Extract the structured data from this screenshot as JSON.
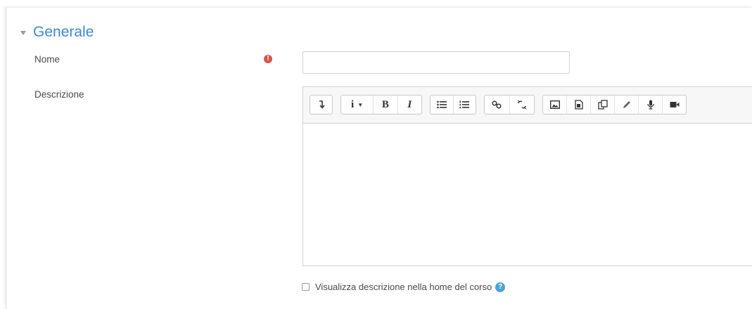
{
  "section": {
    "title": "Generale",
    "collapse_icon": "caret-down-icon"
  },
  "fields": {
    "name": {
      "label": "Nome",
      "required_icon": "exclamation-circle-icon",
      "required_color": "#d9534f",
      "value": "",
      "placeholder": ""
    },
    "description": {
      "label": "Descrizione",
      "content": ""
    }
  },
  "toolbar": {
    "groups": [
      {
        "buttons": [
          {
            "icon": "show-more-buttons-icon",
            "glyph": "↴"
          }
        ]
      },
      {
        "buttons": [
          {
            "icon": "paragraph-style-icon",
            "glyph": "i ▾"
          },
          {
            "icon": "bold-icon",
            "glyph": "B"
          },
          {
            "icon": "italic-icon",
            "glyph": "I"
          }
        ]
      },
      {
        "buttons": [
          {
            "icon": "unordered-list-icon"
          },
          {
            "icon": "ordered-list-icon"
          }
        ]
      },
      {
        "buttons": [
          {
            "icon": "link-icon"
          },
          {
            "icon": "unlink-icon"
          }
        ]
      },
      {
        "buttons": [
          {
            "icon": "image-icon"
          },
          {
            "icon": "media-icon"
          },
          {
            "icon": "manage-files-icon"
          },
          {
            "icon": "pencil-icon"
          },
          {
            "icon": "microphone-icon"
          },
          {
            "icon": "video-camera-icon"
          }
        ]
      }
    ]
  },
  "show_description": {
    "label": "Visualizza descrizione nella home del corso",
    "checked": false,
    "help_icon": "question-circle-icon"
  },
  "colors": {
    "accent": "#3b8ad0",
    "help": "#4ba3d9"
  }
}
